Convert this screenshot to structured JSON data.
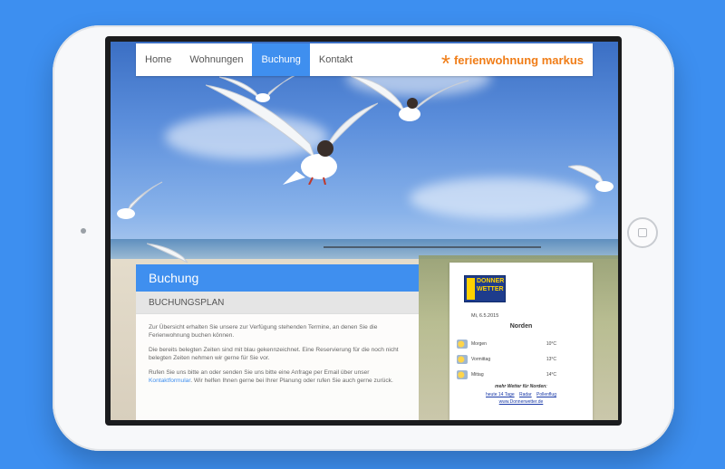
{
  "nav": {
    "items": [
      {
        "label": "Home",
        "active": false
      },
      {
        "label": "Wohnungen",
        "active": false
      },
      {
        "label": "Buchung",
        "active": true
      },
      {
        "label": "Kontakt",
        "active": false
      }
    ],
    "logo_star": "*",
    "logo_text": "ferienwohnung markus"
  },
  "content": {
    "title": "Buchung",
    "subtitle": "BUCHUNGSPLAN",
    "p1": "Zur Übersicht erhalten Sie unsere zur Verfügung stehenden Termine, an denen Sie die Ferienwohnung buchen können.",
    "p2": "Die bereits belegten Zeiten sind mit blau gekennzeichnet. Eine Reservierung für die noch nicht belegten Zeiten nehmen wir gerne für Sie vor.",
    "p3a": "Rufen Sie uns bitte an oder senden Sie uns bitte eine Anfrage per Email über unser",
    "p3_link": "Kontaktformular",
    "p3b": ". Wir helfen Ihnen gerne bei Ihrer Planung oder rufen Sie auch gerne zurück."
  },
  "weather": {
    "logo_line1": "DONNER",
    "logo_line2": "WETTER",
    "date": "Mi, 6.5.2015",
    "city": "Norden",
    "rows": [
      {
        "label": "Morgen",
        "temp": "10°C"
      },
      {
        "label": "Vormittag",
        "temp": "13°C"
      },
      {
        "label": "Mittag",
        "temp": "14°C"
      }
    ],
    "more": "mehr Wetter für Norden:",
    "links": [
      "heute 14 Tage",
      "Radar",
      "Pollenflug"
    ],
    "site": "www.Donnerwetter.de"
  },
  "colors": {
    "accent": "#3f8fef",
    "brand_orange": "#f07d17",
    "background": "#3d8ff0"
  }
}
